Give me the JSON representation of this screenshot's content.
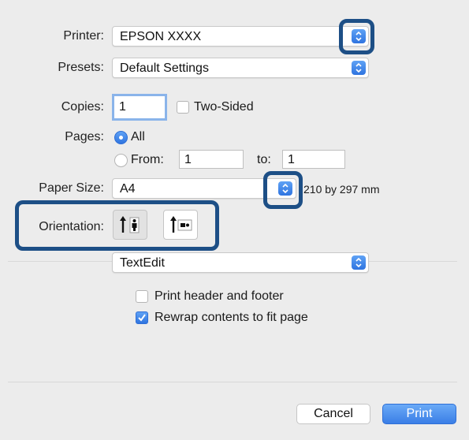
{
  "printer": {
    "label": "Printer:",
    "value": "EPSON XXXX"
  },
  "presets": {
    "label": "Presets:",
    "value": "Default Settings"
  },
  "copies": {
    "label": "Copies:",
    "value": "1",
    "two_sided_label": "Two-Sided",
    "two_sided_checked": false
  },
  "pages": {
    "label": "Pages:",
    "all_label": "All",
    "from_label": "From:",
    "from_value": "1",
    "to_label": "to:",
    "to_value": "1",
    "selected": "All"
  },
  "paper_size": {
    "label": "Paper Size:",
    "value": "A4",
    "dimensions": "210 by 297 mm"
  },
  "orientation": {
    "label": "Orientation:",
    "options": [
      "portrait",
      "landscape"
    ],
    "selected": "portrait"
  },
  "app_section": {
    "value": "TextEdit"
  },
  "options": {
    "print_header_footer": {
      "label": "Print header and footer",
      "checked": false
    },
    "rewrap_contents": {
      "label": "Rewrap contents to fit page",
      "checked": true
    }
  },
  "buttons": {
    "cancel": "Cancel",
    "print": "Print"
  },
  "colors": {
    "accent": "#3a7ee6",
    "highlight": "#1d4f86",
    "background": "#ececec"
  }
}
